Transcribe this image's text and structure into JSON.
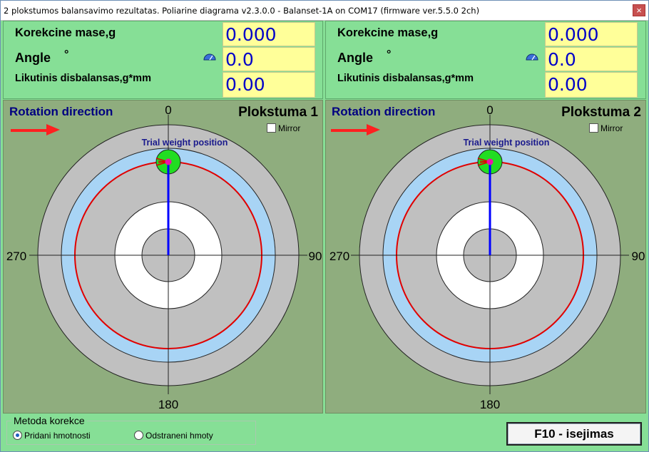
{
  "window": {
    "title": "2 plokstumos balansavimo rezultatas. Poliarine diagrama v2.3.0.0 - Balanset-1A on COM17 (firmware ver.5.5.0 2ch)",
    "close_glyph": "×"
  },
  "results": {
    "mass_label": "Korekcine mase,g",
    "angle_label": "Angle",
    "degree_symbol": "°",
    "residual_label": "Likutinis disbalansas,g*mm",
    "planes": [
      {
        "mass": "0.000",
        "angle": "0.0",
        "residual": "0.00"
      },
      {
        "mass": "0.000",
        "angle": "0.0",
        "residual": "0.00"
      }
    ]
  },
  "polar": {
    "rotation_label": "Rotation direction",
    "mirror_label": "Mirror",
    "trial_label": "Trial weight position",
    "axis_labels": {
      "top": "0",
      "right": "90",
      "bottom": "180",
      "left": "270"
    },
    "planes": [
      {
        "title": "Plokstuma 1",
        "mirror_checked": false,
        "trial_angle_deg": 0,
        "vector_angle_deg": 0
      },
      {
        "title": "Plokstuma 2",
        "mirror_checked": false,
        "trial_angle_deg": 0,
        "vector_angle_deg": 0
      }
    ],
    "colors": {
      "background": "#8fad7e",
      "ring_gray": "#c0c0c0",
      "ring_blue": "#a8d4f5",
      "ring_white": "#ffffff",
      "red_circle": "#e00000",
      "vector": "#0000ff",
      "trial_marker": "#22dd22",
      "center_dot": "#ee11aa"
    }
  },
  "method": {
    "group_label": "Metoda korekce",
    "options": [
      {
        "label": "Pridani hmotnosti",
        "selected": true
      },
      {
        "label": "Odstraneni hmoty",
        "selected": false
      }
    ]
  },
  "exit_button": {
    "label": "F10 - isejimas"
  }
}
